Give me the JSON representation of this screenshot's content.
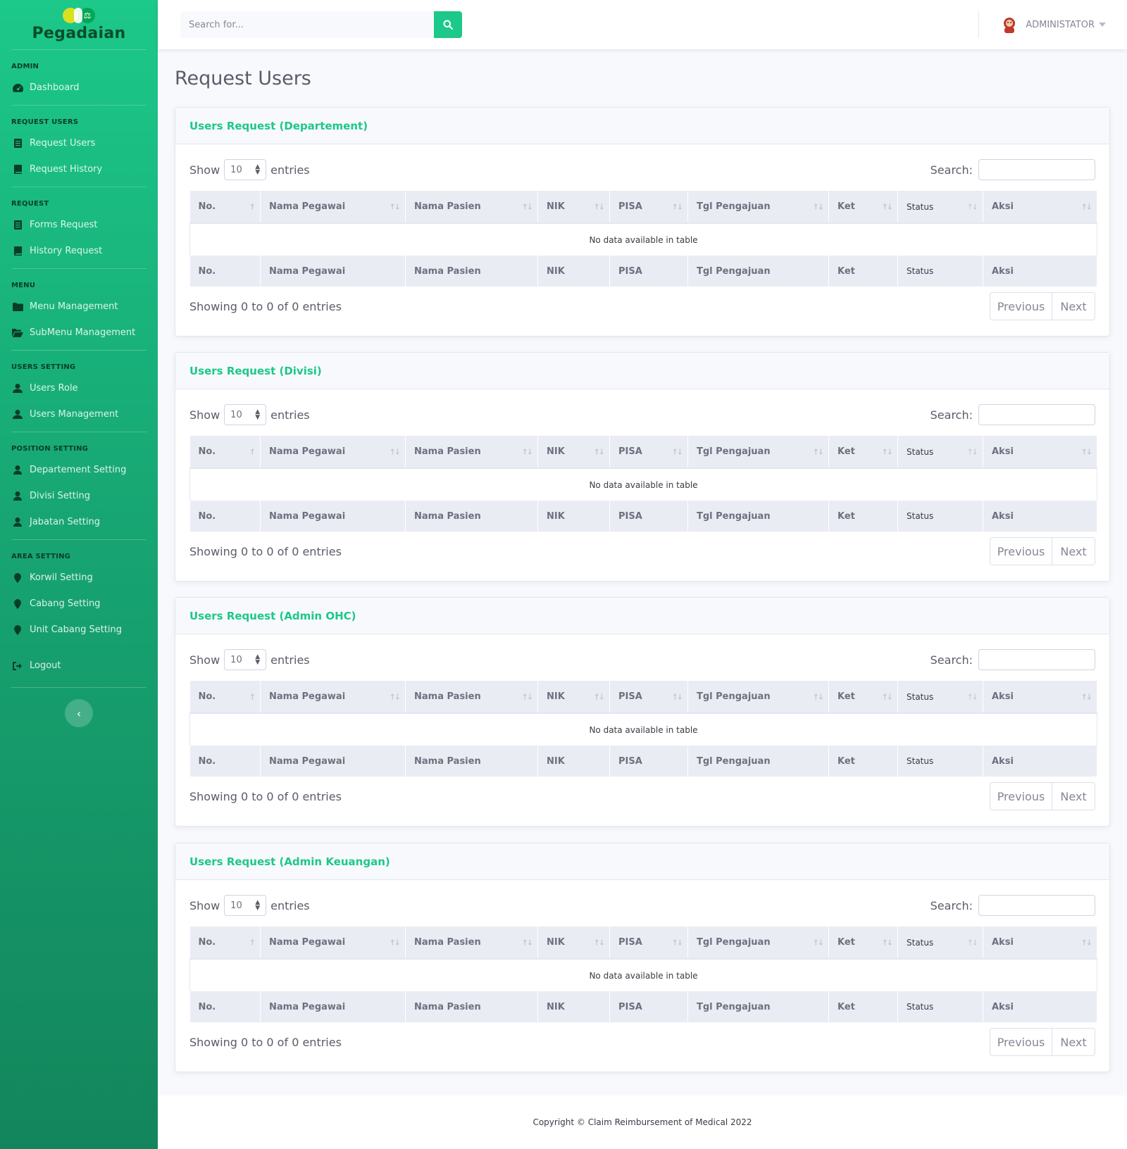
{
  "brand": {
    "name": "Pegadaian"
  },
  "colors": {
    "primary": "#1cc88a",
    "sidebar_dark": "#13855c"
  },
  "sidebar": {
    "sections": [
      {
        "heading": "ADMIN",
        "items": [
          {
            "label": "Dashboard",
            "icon": "dashboard-icon"
          }
        ]
      },
      {
        "heading": "REQUEST USERS",
        "items": [
          {
            "label": "Request Users",
            "icon": "list-icon"
          },
          {
            "label": "Request History",
            "icon": "book-icon"
          }
        ]
      },
      {
        "heading": "REQUEST",
        "items": [
          {
            "label": "Forms Request",
            "icon": "list-icon"
          },
          {
            "label": "History Request",
            "icon": "book-icon"
          }
        ]
      },
      {
        "heading": "MENU",
        "items": [
          {
            "label": "Menu Management",
            "icon": "folder-icon"
          },
          {
            "label": "SubMenu Management",
            "icon": "folder-open-icon"
          }
        ]
      },
      {
        "heading": "USERS SETTING",
        "items": [
          {
            "label": "Users Role",
            "icon": "users-icon"
          },
          {
            "label": "Users Management",
            "icon": "users-icon"
          }
        ]
      },
      {
        "heading": "POSITION SETTING",
        "items": [
          {
            "label": "Departement Setting",
            "icon": "user-icon"
          },
          {
            "label": "Divisi Setting",
            "icon": "user-icon"
          },
          {
            "label": "Jabatan Setting",
            "icon": "user-icon"
          }
        ]
      },
      {
        "heading": "AREA SETTING",
        "items": [
          {
            "label": "Korwil Setting",
            "icon": "map-marker-icon"
          },
          {
            "label": "Cabang Setting",
            "icon": "map-marker-icon"
          },
          {
            "label": "Unit Cabang Setting",
            "icon": "map-marker-icon"
          }
        ]
      }
    ],
    "logout": "Logout",
    "toggle": "‹"
  },
  "topbar": {
    "search_placeholder": "Search for...",
    "user_name": "ADMINISTATOR"
  },
  "page": {
    "title": "Request Users"
  },
  "tables": {
    "show_label": "Show",
    "entries_label": "entries",
    "page_size": "10",
    "search_label": "Search:",
    "columns": [
      "No.",
      "Nama Pegawai",
      "Nama Pasien",
      "NIK",
      "PISA",
      "Tgl Pengajuan",
      "Ket",
      "Status",
      "Aksi"
    ],
    "empty_text": "No data available in table",
    "info_text": "Showing 0 to 0 of 0 entries",
    "prev_label": "Previous",
    "next_label": "Next",
    "cards": [
      {
        "title": "Users Request (Departement)"
      },
      {
        "title": "Users Request (Divisi)"
      },
      {
        "title": "Users Request (Admin OHC)"
      },
      {
        "title": "Users Request (Admin Keuangan)"
      }
    ]
  },
  "footer": {
    "text": "Copyright © Claim Reimbursement of Medical 2022"
  }
}
